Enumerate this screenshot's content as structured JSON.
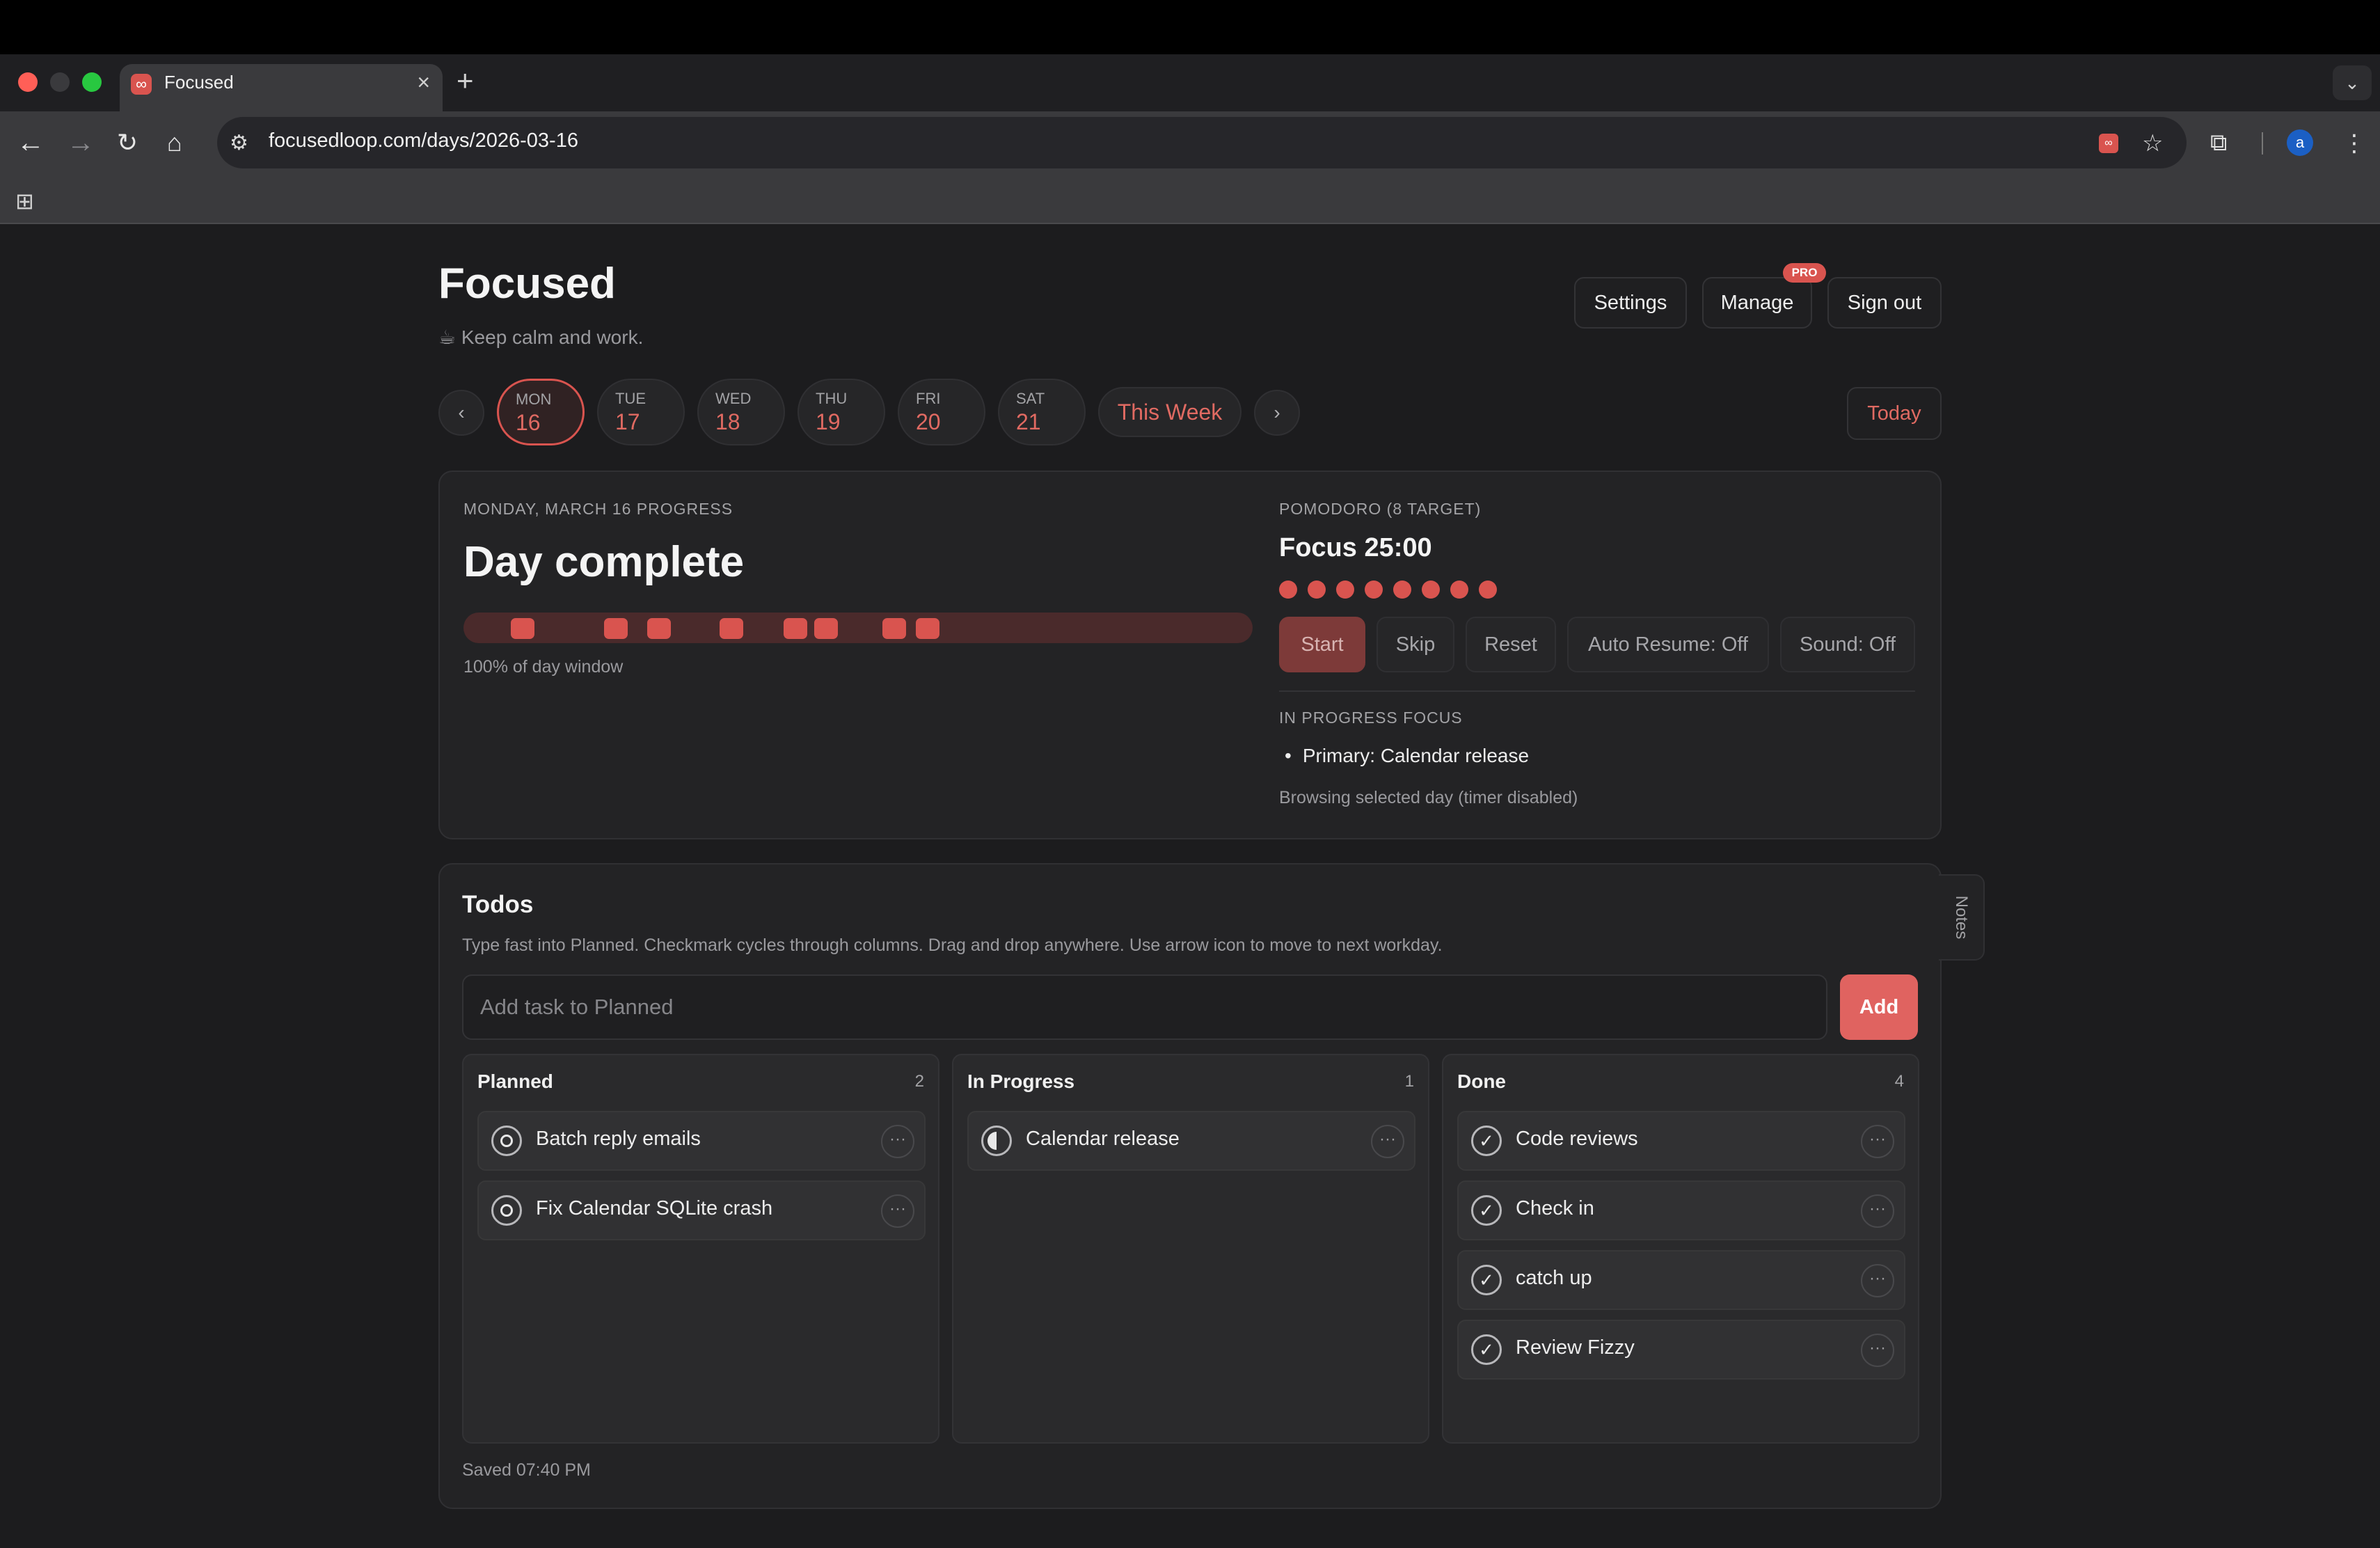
{
  "browser": {
    "tab_title": "Focused",
    "tab_favicon": "∞",
    "tab_close": "×",
    "new_tab": "+",
    "url": "focusedloop.com/days/2026-03-16",
    "ext_badge": "∞",
    "avatar_letter": "a"
  },
  "header": {
    "title": "Focused",
    "tagline": "☕ Keep calm and work.",
    "settings": "Settings",
    "manage": "Manage",
    "pro_badge": "PRO",
    "sign_out": "Sign out"
  },
  "week": {
    "prev": "‹",
    "next": "›",
    "days": [
      {
        "dow": "MON",
        "num": "16"
      },
      {
        "dow": "TUE",
        "num": "17"
      },
      {
        "dow": "WED",
        "num": "18"
      },
      {
        "dow": "THU",
        "num": "19"
      },
      {
        "dow": "FRI",
        "num": "20"
      },
      {
        "dow": "SAT",
        "num": "21"
      }
    ],
    "selected_index": 0,
    "this_week": "This Week",
    "today": "Today"
  },
  "progress": {
    "eyebrow": "MONDAY, MARCH 16 PROGRESS",
    "status": "Day complete",
    "percent_label": "100% of day window",
    "window_fraction": 1.0
  },
  "pomodoro": {
    "eyebrow": "POMODORO (8 TARGET)",
    "focus": "Focus 25:00",
    "target": 8,
    "buttons": {
      "start": "Start",
      "skip": "Skip",
      "reset": "Reset",
      "auto_resume": "Auto Resume: Off",
      "sound": "Sound: Off"
    },
    "in_progress_label": "IN PROGRESS FOCUS",
    "in_progress_item": "Primary: Calendar release",
    "note": "Browsing selected day (timer disabled)"
  },
  "todos": {
    "title": "Todos",
    "description": "Type fast into Planned. Checkmark cycles through columns. Drag and drop anywhere. Use arrow icon to move to next workday.",
    "input_placeholder": "Add task to Planned",
    "add": "Add",
    "notes_tab": "Notes",
    "more_glyph": "···",
    "columns": [
      {
        "title": "Planned",
        "count": "2",
        "tasks": [
          "Batch reply emails",
          "Fix Calendar SQLite crash"
        ]
      },
      {
        "title": "In Progress",
        "count": "1",
        "tasks": [
          "Calendar release"
        ]
      },
      {
        "title": "Done",
        "count": "4",
        "tasks": [
          "Code reviews",
          "Check in",
          "catch up",
          "Review Fizzy"
        ]
      }
    ],
    "saved": "Saved 07:40 PM"
  },
  "colors": {
    "accent": "#d9544f",
    "background": "#1c1c1e",
    "card": "#232325"
  }
}
